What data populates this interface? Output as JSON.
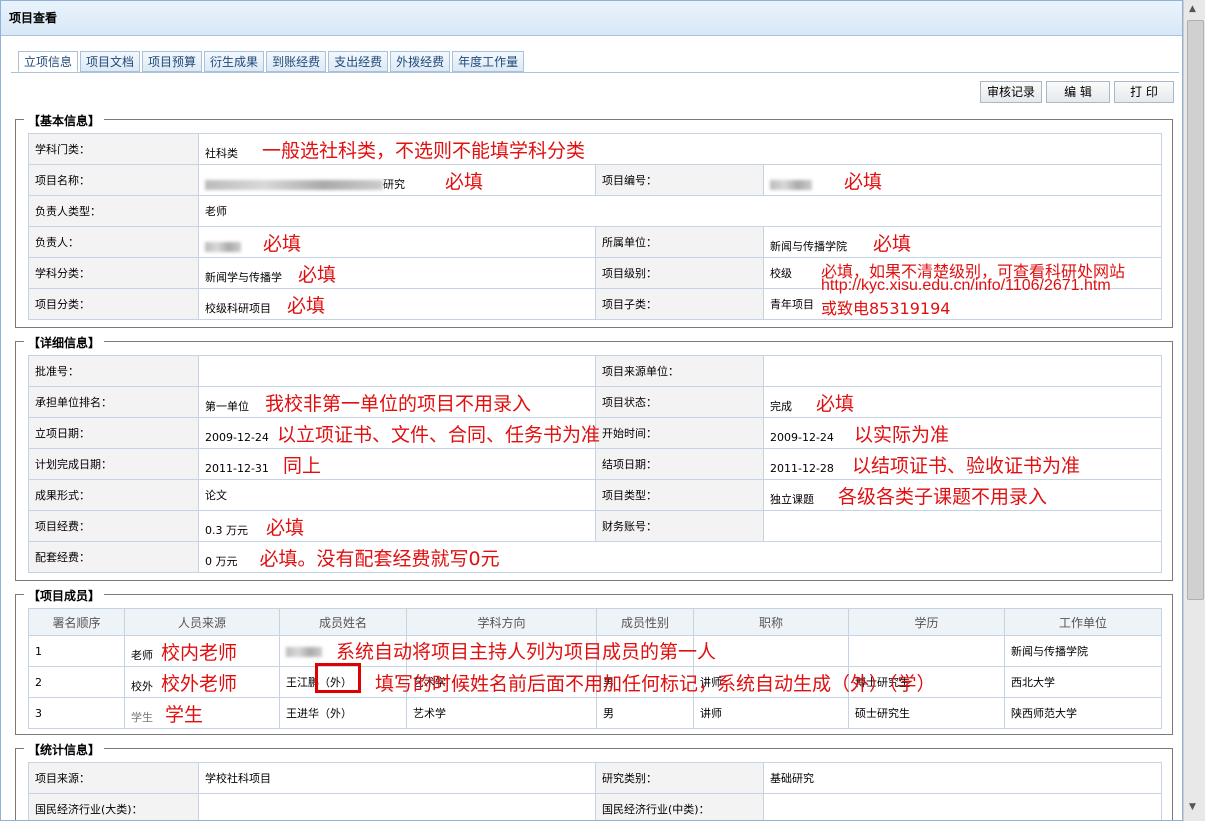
{
  "window": {
    "title": "项目查看"
  },
  "tabs": [
    "立项信息",
    "项目文档",
    "项目预算",
    "衍生成果",
    "到账经费",
    "支出经费",
    "外拨经费",
    "年度工作量"
  ],
  "buttons": {
    "audit": "审核记录",
    "edit": "编 辑",
    "print": "打 印"
  },
  "basic": {
    "legend": "【基本信息】",
    "discipline_category": {
      "label": "学科门类：",
      "value": "社科类",
      "note": "一般选社科类，不选则不能填学科分类"
    },
    "project_name": {
      "label": "项目名称：",
      "value": "研究",
      "note": "必填"
    },
    "project_no": {
      "label": "项目编号：",
      "note": "必填"
    },
    "leader_type": {
      "label": "负责人类型：",
      "value": "老师"
    },
    "leader": {
      "label": "负责人：",
      "note": "必填"
    },
    "unit": {
      "label": "所属单位：",
      "value": "新闻与传播学院",
      "note": "必填"
    },
    "subject": {
      "label": "学科分类：",
      "value": "新闻学与传播学",
      "note": "必填"
    },
    "level": {
      "label": "项目级别：",
      "value": "校级",
      "note1": "必填，如果不清楚级别，可查看科研处网站",
      "note2": "http://kyc.xisu.edu.cn/info/1106/2671.htm",
      "note3": "或致电85319194"
    },
    "category": {
      "label": "项目分类：",
      "value": "校级科研项目",
      "note": "必填"
    },
    "subcategory": {
      "label": "项目子类：",
      "value": "青年项目"
    }
  },
  "detail": {
    "legend": "【详细信息】",
    "approval_no": {
      "label": "批准号："
    },
    "source_unit": {
      "label": "项目来源单位："
    },
    "unit_rank": {
      "label": "承担单位排名：",
      "value": "第一单位",
      "note": "我校非第一单位的项目不用录入"
    },
    "status": {
      "label": "项目状态：",
      "value": "完成",
      "note": "必填"
    },
    "setup_date": {
      "label": "立项日期：",
      "value": "2009-12-24",
      "note": "以立项证书、文件、合同、任务书为准"
    },
    "start_date": {
      "label": "开始时间：",
      "value": "2009-12-24",
      "note": "以实际为准"
    },
    "plan_end": {
      "label": "计划完成日期：",
      "value": "2011-12-31",
      "note": "同上"
    },
    "end_date": {
      "label": "结项日期：",
      "value": "2011-12-28",
      "note": "以结项证书、验收证书为准"
    },
    "result_form": {
      "label": "成果形式：",
      "value": "论文"
    },
    "project_type": {
      "label": "项目类型：",
      "value": "独立课题",
      "note": "各级各类子课题不用录入"
    },
    "funds": {
      "label": "项目经费：",
      "value": "0.3 万元",
      "note": "必填"
    },
    "account": {
      "label": "财务账号："
    },
    "matching": {
      "label": "配套经费：",
      "value": "0 万元",
      "note": "必填。没有配套经费就写0元"
    }
  },
  "members": {
    "legend": "【项目成员】",
    "headers": [
      "署名顺序",
      "人员来源",
      "成员姓名",
      "学科方向",
      "成员性别",
      "职称",
      "学历",
      "工作单位"
    ],
    "rows": [
      {
        "order": "1",
        "source": "老师",
        "source_note": "校内老师",
        "name": "",
        "dir": "",
        "gender": "",
        "title": "",
        "edu": "",
        "work": "新闻与传播学院"
      },
      {
        "order": "2",
        "source": "校外",
        "source_note": "校外老师",
        "name": "王江鹏（外）",
        "dir": "艺术学",
        "gender": "男",
        "title": "讲师",
        "edu": "博士研究生",
        "work": "西北大学"
      },
      {
        "order": "3",
        "source": "学生",
        "source_note": "学生",
        "name": "王进华（外）",
        "dir": "艺术学",
        "gender": "男",
        "title": "讲师",
        "edu": "硕士研究生",
        "work": "陕西师范大学"
      }
    ],
    "note_row1": "系统自动将项目主持人列为项目成员的第一人",
    "note_row2": "填写的时候姓名前后面不用加任何标记，系统自动生成（外）（学）"
  },
  "stats": {
    "legend": "【统计信息】",
    "source": {
      "label": "项目来源：",
      "value": "学校社科项目"
    },
    "research_type": {
      "label": "研究类别：",
      "value": "基础研究"
    },
    "industry_big": {
      "label": "国民经济行业(大类)："
    },
    "industry_mid": {
      "label": "国民经济行业(中类)："
    }
  },
  "colors": {
    "note": "#e01010",
    "tab_text": "#1f4a7a",
    "border": "#c5d3e2"
  }
}
